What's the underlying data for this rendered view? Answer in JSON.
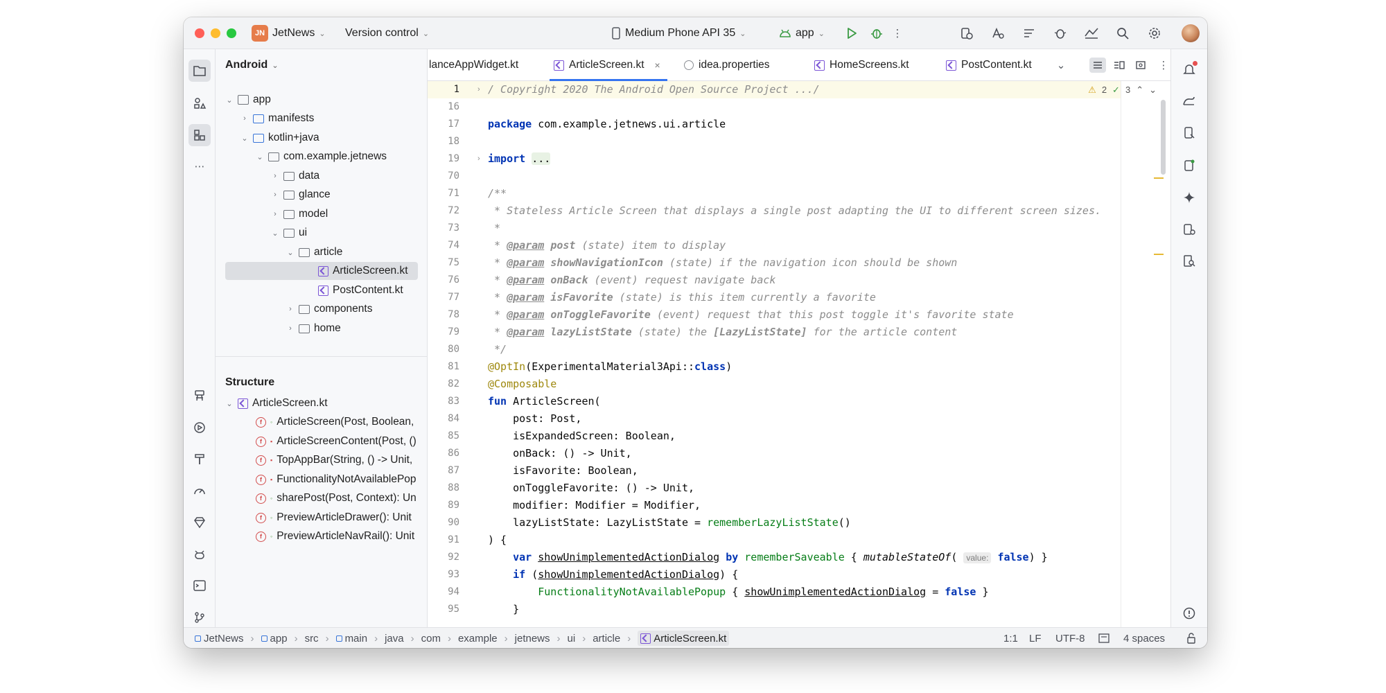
{
  "titlebar": {
    "project_badge": "JN",
    "project_name": "JetNews",
    "vcs": "Version control",
    "device": "Medium Phone API 35",
    "run_config": "app"
  },
  "project_panel": {
    "view_mode": "Android",
    "tree": [
      {
        "label": "app",
        "depth": 0,
        "expanded": true,
        "icon": "app"
      },
      {
        "label": "manifests",
        "depth": 1,
        "expanded": false,
        "icon": "folder-blue"
      },
      {
        "label": "kotlin+java",
        "depth": 1,
        "expanded": true,
        "icon": "folder-blue"
      },
      {
        "label": "com.example.jetnews",
        "depth": 2,
        "expanded": true,
        "icon": "package"
      },
      {
        "label": "data",
        "depth": 3,
        "expanded": false,
        "icon": "package"
      },
      {
        "label": "glance",
        "depth": 3,
        "expanded": false,
        "icon": "package"
      },
      {
        "label": "model",
        "depth": 3,
        "expanded": false,
        "icon": "package"
      },
      {
        "label": "ui",
        "depth": 3,
        "expanded": true,
        "icon": "package"
      },
      {
        "label": "article",
        "depth": 4,
        "expanded": true,
        "icon": "package"
      },
      {
        "label": "ArticleScreen.kt",
        "depth": 5,
        "selected": true,
        "icon": "kotlin-file"
      },
      {
        "label": "PostContent.kt",
        "depth": 5,
        "icon": "kotlin-file"
      },
      {
        "label": "components",
        "depth": 4,
        "expanded": false,
        "icon": "package"
      },
      {
        "label": "home",
        "depth": 4,
        "expanded": false,
        "icon": "package"
      }
    ],
    "structure_title": "Structure",
    "structure_root": "ArticleScreen.kt",
    "structure_items": [
      {
        "label": "ArticleScreen(Post, Boolean,",
        "visibility": "public"
      },
      {
        "label": "ArticleScreenContent(Post, ()",
        "visibility": "private"
      },
      {
        "label": "TopAppBar(String, () -> Unit,",
        "visibility": "private"
      },
      {
        "label": "FunctionalityNotAvailablePop",
        "visibility": "private"
      },
      {
        "label": "sharePost(Post, Context): Un",
        "visibility": "public"
      },
      {
        "label": "PreviewArticleDrawer(): Unit",
        "visibility": "public"
      },
      {
        "label": "PreviewArticleNavRail(): Unit",
        "visibility": "public"
      }
    ]
  },
  "tabs": [
    {
      "label": "lanceAppWidget.kt",
      "icon": "none",
      "active": false
    },
    {
      "label": "ArticleScreen.kt",
      "icon": "kotlin-file",
      "active": true,
      "close": "×"
    },
    {
      "label": "idea.properties",
      "icon": "gear",
      "active": false
    },
    {
      "label": "HomeScreens.kt",
      "icon": "kotlin-file",
      "active": false
    },
    {
      "label": "PostContent.kt",
      "icon": "kotlin-file",
      "active": false
    }
  ],
  "inspections": {
    "warnings": "2",
    "ok": "3"
  },
  "gutter": [
    "1",
    "16",
    "17",
    "18",
    "19",
    "70",
    "71",
    "72",
    "73",
    "74",
    "75",
    "76",
    "77",
    "78",
    "79",
    "80",
    "81",
    "82",
    "83",
    "84",
    "85",
    "86",
    "87",
    "88",
    "89",
    "90",
    "91",
    "92",
    "93",
    "94",
    "95"
  ],
  "code": {
    "l1": "/ Copyright 2020 The Android Open Source Project .../",
    "l17_kw": "package",
    "l17_rest": " com.example.jetnews.ui.article",
    "l19_kw": "import",
    "l19_fold": "...",
    "l71": "/**",
    "l72": " * Stateless Article Screen that displays a single post adapting the UI to different screen sizes.",
    "l73": " *",
    "params": [
      {
        "name": "post",
        "desc": " (state) item to display"
      },
      {
        "name": "showNavigationIcon",
        "desc": " (state) if the navigation icon should be shown"
      },
      {
        "name": "onBack",
        "desc": " (event) request navigate back"
      },
      {
        "name": "isFavorite",
        "desc": " (state) is this item currently a favorite"
      },
      {
        "name": "onToggleFavorite",
        "desc": " (event) request that this post toggle it's favorite state"
      },
      {
        "name": "lazyListState",
        "desc": " (state) the "
      }
    ],
    "star": " * ",
    "param_tag": "@param",
    "l79_ref": "[LazyListState]",
    "l79_tail": " for the article content",
    "l80": " */",
    "l81_an": "@OptIn",
    "l81_a": "(ExperimentalMaterial3Api::",
    "l81_kw": "class",
    "l81_b": ")",
    "l82": "@Composable",
    "l83_kw": "fun",
    "l83_rest": " ArticleScreen(",
    "l84": "    post: Post,",
    "l85": "    isExpandedScreen: Boolean,",
    "l86": "    onBack: () -> Unit,",
    "l87": "    isFavorite: Boolean,",
    "l88": "    onToggleFavorite: () -> Unit,",
    "l89": "    modifier: Modifier = Modifier,",
    "l90_a": "    lazyListState: LazyListState = ",
    "l90_fn": "rememberLazyListState",
    "l90_b": "()",
    "l91": ") {",
    "l92_kw": "var",
    "l92_var": "showUnimplementedActionDialog",
    "l92_by": "by",
    "l92_fn": "rememberSaveable",
    "l92_brace": " { ",
    "l92_call": "mutableStateOf",
    "l92_hint": "value:",
    "l92_false": "false",
    "l92_end": ") }",
    "l93_kw": "if",
    "l93_var": "showUnimplementedActionDialog",
    "l93_end": ") {",
    "l94_fn": "FunctionalityNotAvailablePopup",
    "l94_var": "showUnimplementedActionDialog",
    "l94_false": "false",
    "l95": "    }"
  },
  "statusbar": {
    "crumbs": [
      "JetNews",
      "app",
      "src",
      "main",
      "java",
      "com",
      "example",
      "jetnews",
      "ui",
      "article"
    ],
    "file": "ArticleScreen.kt",
    "position": "1:1",
    "line_sep": "LF",
    "encoding": "UTF-8",
    "indent": "4 spaces"
  },
  "colors": {
    "accent": "#3574f0",
    "keyword": "#0033b3",
    "annotation": "#9e880d",
    "function_call": "#00627a",
    "comment": "#8c8c8c",
    "project_badge": "#e67c4a"
  }
}
